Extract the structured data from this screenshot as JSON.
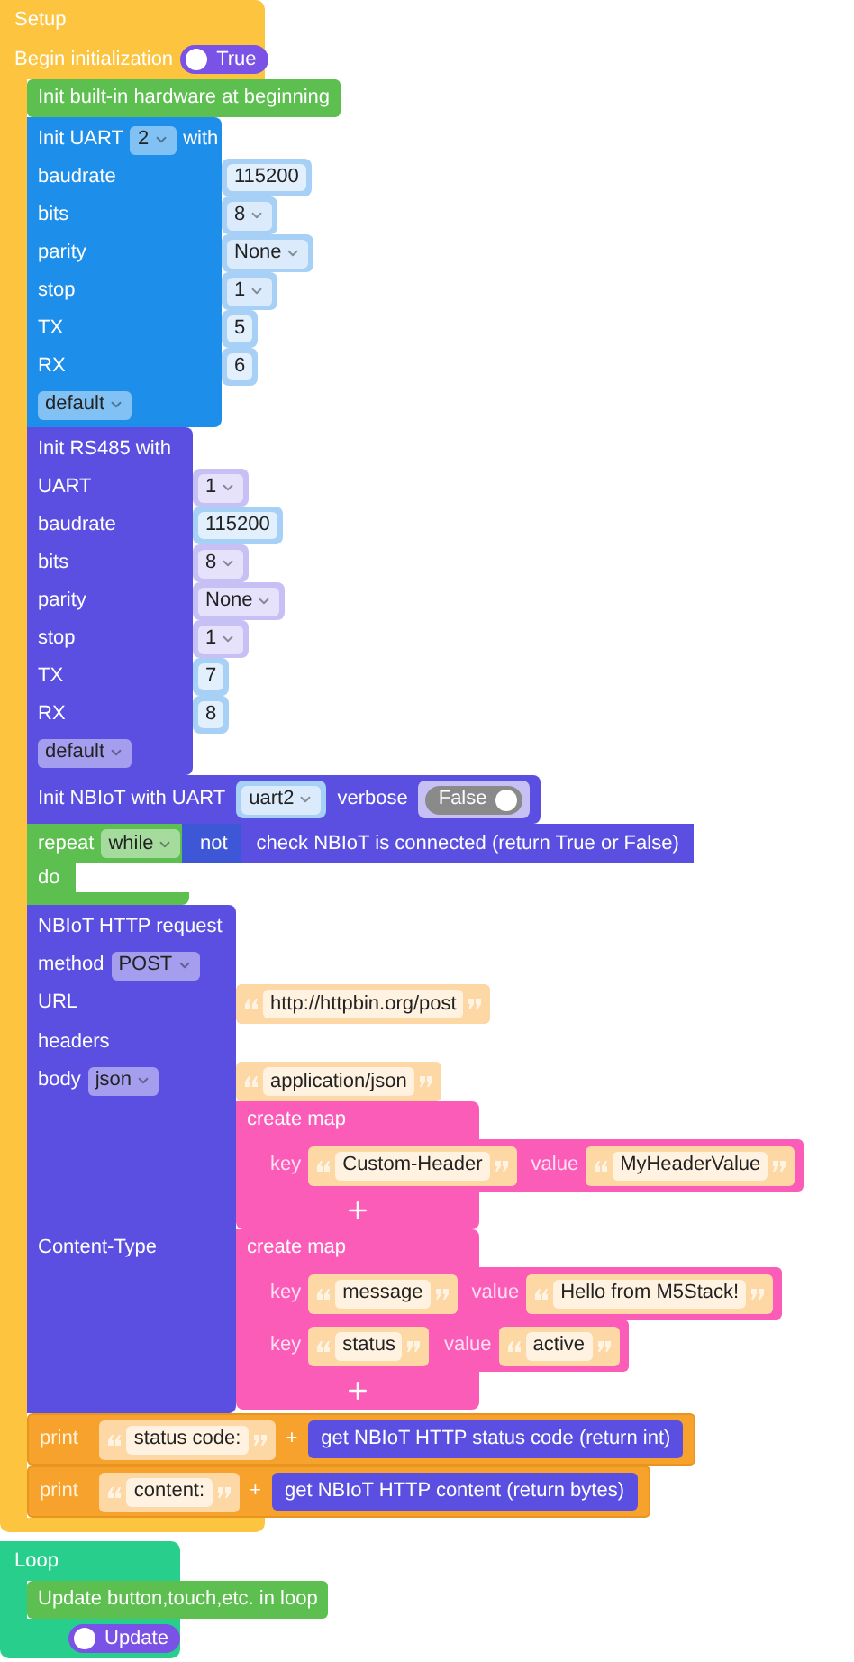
{
  "setup": {
    "title": "Setup",
    "begin_label": "Begin initialization",
    "begin_toggle": {
      "label": "True",
      "on": true
    },
    "blocks": [
      {
        "kind": "hardware",
        "text": "Init built-in hardware at beginning"
      },
      {
        "kind": "uart",
        "title": {
          "before": "Init UART",
          "dropdown": "2",
          "after": "with"
        },
        "rows": [
          {
            "label": "baudrate",
            "input": {
              "kind": "number",
              "value": "115200"
            }
          },
          {
            "label": "bits",
            "input": {
              "kind": "select",
              "value": "8"
            }
          },
          {
            "label": "parity",
            "input": {
              "kind": "select",
              "value": "None"
            }
          },
          {
            "label": "stop",
            "input": {
              "kind": "select",
              "value": "1"
            }
          },
          {
            "label": "TX",
            "input": {
              "kind": "number",
              "value": "5"
            }
          },
          {
            "label": "RX",
            "input": {
              "kind": "number",
              "value": "6"
            }
          }
        ],
        "footer_dropdown": "default"
      },
      {
        "kind": "rs485",
        "title": {
          "before": "Init RS485 with"
        },
        "rows": [
          {
            "label": "UART",
            "input": {
              "kind": "select",
              "value": "1"
            }
          },
          {
            "label": "baudrate",
            "input": {
              "kind": "number",
              "value": "115200"
            }
          },
          {
            "label": "bits",
            "input": {
              "kind": "select",
              "value": "8"
            }
          },
          {
            "label": "parity",
            "input": {
              "kind": "select",
              "value": "None"
            }
          },
          {
            "label": "stop",
            "input": {
              "kind": "select",
              "value": "1"
            }
          },
          {
            "label": "TX",
            "input": {
              "kind": "number",
              "value": "7"
            }
          },
          {
            "label": "RX",
            "input": {
              "kind": "number",
              "value": "8"
            }
          }
        ],
        "footer_dropdown": "default"
      },
      {
        "kind": "nbiot_init",
        "parts": [
          {
            "kind": "label",
            "text": "Init NBIoT with UART"
          },
          {
            "kind": "uart_select",
            "value": "uart2"
          },
          {
            "kind": "label",
            "text": "verbose"
          },
          {
            "kind": "toggle",
            "label": "False",
            "on": false
          }
        ]
      },
      {
        "kind": "repeat",
        "label": "repeat",
        "dropdown": "while",
        "not_label": "not",
        "condition": "check NBIoT is connected (return True or False)",
        "do_label": "do"
      },
      {
        "kind": "http_request",
        "title": {
          "before": "NBIoT HTTP request"
        },
        "rows": [
          {
            "label": "method",
            "dropdown": "POST"
          },
          {
            "label": "URL",
            "input": {
              "kind": "text",
              "value": "http://httpbin.org/post"
            }
          },
          {
            "label": "headers"
          },
          {
            "label": "body",
            "dropdown": "json",
            "input": {
              "kind": "text",
              "value": "application/json"
            }
          },
          {
            "input": {
              "kind": "map",
              "title": "create map",
              "entries": [
                {
                  "key_label": "key",
                  "key": "Custom-Header",
                  "value_label": "value",
                  "value": "MyHeaderValue"
                }
              ]
            }
          },
          {
            "label": "Content-Type",
            "input": {
              "kind": "map",
              "title": "create map",
              "entries": [
                {
                  "key_label": "key",
                  "key": "message",
                  "value_label": "value",
                  "value": "Hello from M5Stack!"
                },
                {
                  "key_label": "key",
                  "key": "status",
                  "value_label": "value",
                  "value": "active"
                }
              ]
            }
          }
        ]
      },
      {
        "kind": "print",
        "label": "print",
        "text": "status code:",
        "op": "+",
        "getter": "get NBIoT HTTP status code (return int)"
      },
      {
        "kind": "print",
        "label": "print",
        "text": "content:",
        "op": "+",
        "getter": "get NBIoT HTTP content (return bytes)"
      }
    ]
  },
  "loop": {
    "title": "Loop",
    "blocks": [
      {
        "kind": "update",
        "text": "Update button,touch,etc. in loop"
      }
    ],
    "toggle": {
      "label": "Update",
      "on": true
    }
  }
}
